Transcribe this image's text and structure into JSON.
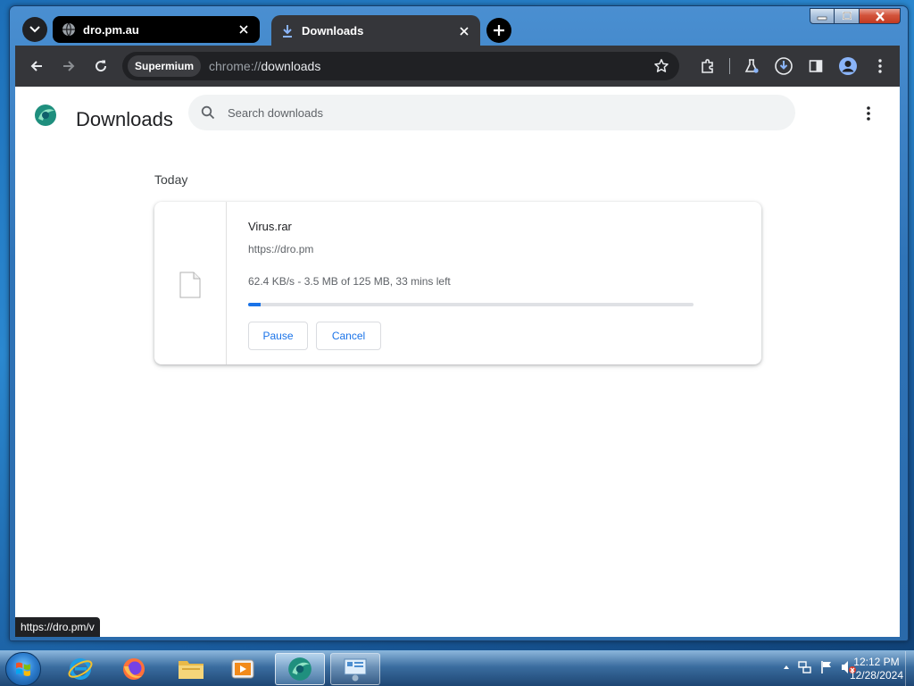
{
  "browser": {
    "tabs": [
      {
        "title": "dro.pm.au",
        "active": false,
        "icon": "globe-icon"
      },
      {
        "title": "Downloads",
        "active": true,
        "icon": "download-icon"
      }
    ],
    "site_chip": "Supermium",
    "url_scheme": "chrome://",
    "url_path": "downloads"
  },
  "page": {
    "title": "Downloads",
    "search_placeholder": "Search downloads",
    "section_label": "Today",
    "download": {
      "filename": "Virus.rar",
      "source": "https://dro.pm",
      "status": "62.4 KB/s - 3.5 MB of 125 MB, 33 mins left",
      "progress_fraction": 0.028,
      "pause_label": "Pause",
      "cancel_label": "Cancel"
    },
    "status_bar_url": "https://dro.pm/v"
  },
  "taskbar": {
    "apps": [
      "internet-explorer-icon",
      "firefox-icon",
      "file-explorer-icon",
      "media-player-icon",
      "supermium-icon",
      "control-panel-icon"
    ],
    "time": "12:12 PM",
    "date": "12/28/2024"
  },
  "colors": {
    "accent": "#1a73e8",
    "toolbar": "#35363a",
    "tab_inactive": "#000000"
  }
}
